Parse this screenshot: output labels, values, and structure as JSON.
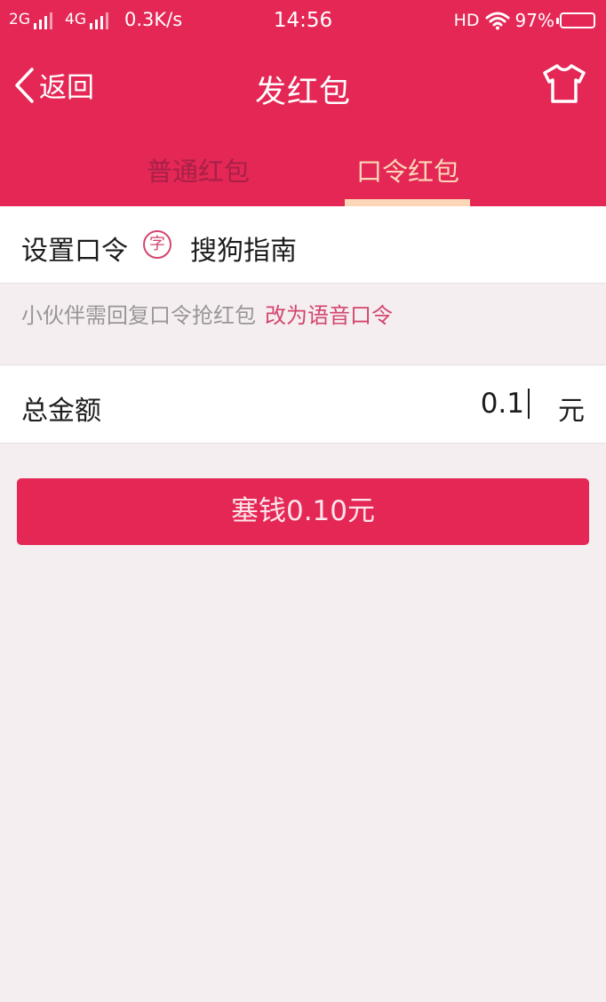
{
  "status_bar": {
    "net1": "2G",
    "net2": "4G",
    "speed": "0.3K/s",
    "time": "14:56",
    "hd": "HD",
    "battery": "97%"
  },
  "nav": {
    "back_label": "返回",
    "title": "发红包",
    "back_icon": "chevron-left-icon",
    "right_icon": "tshirt-icon"
  },
  "tabs": [
    {
      "label": "普通红包",
      "active": false
    },
    {
      "label": "口令红包",
      "active": true
    }
  ],
  "password": {
    "label": "设置口令",
    "type_icon_char": "字",
    "value": "搜狗指南"
  },
  "hint": {
    "text": "小伙伴需回复口令抢红包",
    "link": "改为语音口令"
  },
  "amount": {
    "label": "总金额",
    "value": "0.1",
    "unit": "元"
  },
  "submit": {
    "label": "塞钱0.10元"
  },
  "colors": {
    "brand": "#e42755",
    "tab_active": "#fbd7b8",
    "link": "#d3466d",
    "background": "#f4eef0"
  }
}
